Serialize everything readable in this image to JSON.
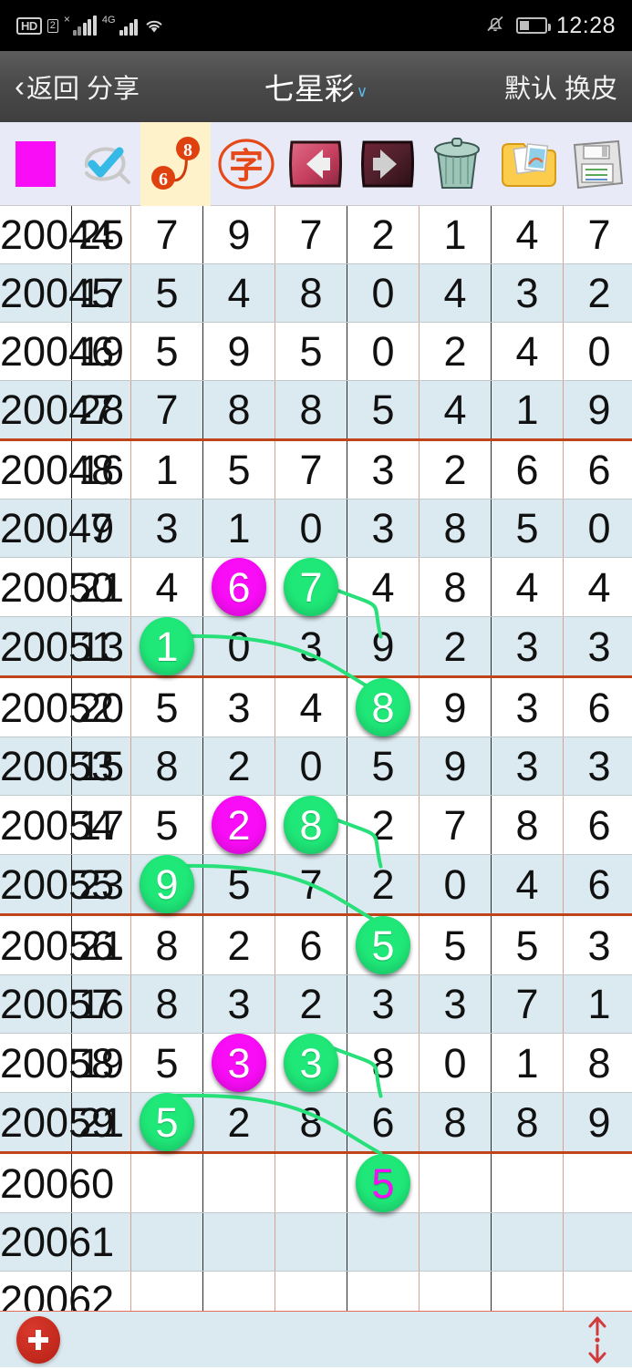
{
  "statusbar": {
    "hd_label": "HD",
    "sim_label": "2",
    "net_label": "4G",
    "x_label": "×",
    "time": "12:28",
    "icons": [
      "hd-icon",
      "sim2-icon",
      "signal-bars-icon",
      "signal-bars-4g-icon",
      "wifi-icon",
      "bell-off-icon",
      "battery-icon"
    ]
  },
  "titlebar": {
    "back_label": "返回 分享",
    "back_chevron": "‹",
    "title": "七星彩",
    "title_caret": "∨",
    "right_label": "默认 换皮"
  },
  "toolbar": {
    "items": [
      {
        "name": "color-swatch-pink-icon",
        "label": "",
        "highlighted": false
      },
      {
        "name": "check-erase-icon",
        "label": "",
        "highlighted": false
      },
      {
        "name": "connect-numbers-6-8-icon",
        "label": "",
        "highlighted": true,
        "badge_a": "6",
        "badge_b": "8"
      },
      {
        "name": "chinese-zi-stamp-icon",
        "label": "字",
        "highlighted": false
      },
      {
        "name": "arrow-left-icon",
        "label": "",
        "highlighted": false
      },
      {
        "name": "arrow-right-icon",
        "label": "",
        "highlighted": false
      },
      {
        "name": "trash-bin-icon",
        "label": "",
        "highlighted": false
      },
      {
        "name": "photo-folder-icon",
        "label": "",
        "highlighted": false
      },
      {
        "name": "floppy-save-icon",
        "label": "",
        "highlighted": false
      }
    ]
  },
  "table": {
    "columns": [
      "issue",
      "sum",
      "d1",
      "d2",
      "d3",
      "d4",
      "d5",
      "d6",
      "d7"
    ],
    "rows": [
      {
        "issue": "20044",
        "sum": "25",
        "digits": [
          "7",
          "9",
          "7",
          "2",
          "1",
          "4",
          "7"
        ],
        "group_end": false
      },
      {
        "issue": "20045",
        "sum": "17",
        "digits": [
          "5",
          "4",
          "8",
          "0",
          "4",
          "3",
          "2"
        ],
        "group_end": false
      },
      {
        "issue": "20046",
        "sum": "19",
        "digits": [
          "5",
          "9",
          "5",
          "0",
          "2",
          "4",
          "0"
        ],
        "group_end": false
      },
      {
        "issue": "20047",
        "sum": "28",
        "digits": [
          "7",
          "8",
          "8",
          "5",
          "4",
          "1",
          "9"
        ],
        "group_end": true
      },
      {
        "issue": "20048",
        "sum": "16",
        "digits": [
          "1",
          "5",
          "7",
          "3",
          "2",
          "6",
          "6"
        ],
        "group_end": false
      },
      {
        "issue": "20049",
        "sum": "7",
        "digits": [
          "3",
          "1",
          "0",
          "3",
          "8",
          "5",
          "0"
        ],
        "group_end": false
      },
      {
        "issue": "20050",
        "sum": "21",
        "digits": [
          "4",
          "6",
          "7",
          "4",
          "8",
          "4",
          "4"
        ],
        "group_end": false,
        "marks": {
          "1": "pink",
          "2": "green"
        }
      },
      {
        "issue": "20051",
        "sum": "13",
        "digits": [
          "1",
          "0",
          "3",
          "9",
          "2",
          "3",
          "3"
        ],
        "group_end": true,
        "marks": {
          "0": "green"
        }
      },
      {
        "issue": "20052",
        "sum": "20",
        "digits": [
          "5",
          "3",
          "4",
          "8",
          "9",
          "3",
          "6"
        ],
        "group_end": false,
        "marks": {
          "3": "green"
        }
      },
      {
        "issue": "20053",
        "sum": "15",
        "digits": [
          "8",
          "2",
          "0",
          "5",
          "9",
          "3",
          "3"
        ],
        "group_end": false
      },
      {
        "issue": "20054",
        "sum": "17",
        "digits": [
          "5",
          "2",
          "8",
          "2",
          "7",
          "8",
          "6"
        ],
        "group_end": false,
        "marks": {
          "1": "pink",
          "2": "green"
        }
      },
      {
        "issue": "20055",
        "sum": "23",
        "digits": [
          "9",
          "5",
          "7",
          "2",
          "0",
          "4",
          "6"
        ],
        "group_end": true,
        "marks": {
          "0": "green"
        }
      },
      {
        "issue": "20056",
        "sum": "21",
        "digits": [
          "8",
          "2",
          "6",
          "5",
          "5",
          "5",
          "3"
        ],
        "group_end": false,
        "marks": {
          "3": "green"
        }
      },
      {
        "issue": "20057",
        "sum": "16",
        "digits": [
          "8",
          "3",
          "2",
          "3",
          "3",
          "7",
          "1"
        ],
        "group_end": false
      },
      {
        "issue": "20058",
        "sum": "19",
        "digits": [
          "5",
          "3",
          "3",
          "8",
          "0",
          "1",
          "8"
        ],
        "group_end": false,
        "marks": {
          "1": "pink",
          "2": "green"
        }
      },
      {
        "issue": "20059",
        "sum": "21",
        "digits": [
          "5",
          "2",
          "8",
          "6",
          "8",
          "8",
          "9"
        ],
        "group_end": true,
        "marks": {
          "0": "green"
        }
      },
      {
        "issue": "20060",
        "sum": "",
        "digits": [
          "",
          "",
          "",
          "5",
          "",
          "",
          ""
        ],
        "group_end": false,
        "marks": {
          "3": "green-pink"
        }
      },
      {
        "issue": "20061",
        "sum": "",
        "digits": [
          "",
          "",
          "",
          "",
          "",
          "",
          ""
        ],
        "group_end": false
      },
      {
        "issue": "20062",
        "sum": "",
        "digits": [
          "",
          "",
          "",
          "",
          "",
          "",
          ""
        ],
        "group_end": false
      }
    ]
  },
  "connectors": {
    "color": "#27e07a",
    "paths": [
      {
        "from_row": 6,
        "from_col": 2,
        "to_row": 7,
        "to_col": 3,
        "name": "link-20050-col3-to-20052-col4"
      },
      {
        "from_row": 7,
        "from_col": 0,
        "to_row": 8,
        "to_col": 3,
        "name": "link-20051-col1-to-20052-col4"
      },
      {
        "from_row": 10,
        "from_col": 2,
        "to_row": 11,
        "to_col": 3,
        "name": "link-20054-col3-to-20056-col4"
      },
      {
        "from_row": 11,
        "from_col": 0,
        "to_row": 12,
        "to_col": 3,
        "name": "link-20055-col1-to-20056-col4"
      },
      {
        "from_row": 14,
        "from_col": 2,
        "to_row": 15,
        "to_col": 3,
        "name": "link-20058-col3-to-20060-col4"
      },
      {
        "from_row": 15,
        "from_col": 0,
        "to_row": 16,
        "to_col": 3,
        "name": "link-20059-col1-to-20060-col4"
      }
    ]
  },
  "bottombar": {
    "add_label": "+",
    "scroll_label": "↕"
  },
  "colors": {
    "accent_orange": "#c0441a",
    "issue_text": "#c7502a",
    "alt_row": "#dbeaf0",
    "mark_green": "#1fe878",
    "mark_pink": "#f90cf6",
    "toolbar_bg": "#e9eaf7",
    "highlight_bg": "#fdf2c9"
  }
}
